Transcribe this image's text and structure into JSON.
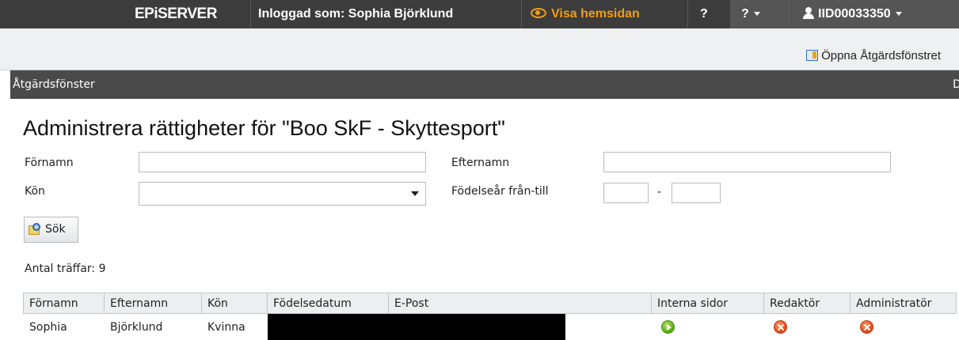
{
  "topbar": {
    "logo": "EPiSERVER",
    "logged_in_as": "Inloggad som: Sophia Björklund",
    "view_site": "Visa hemsidan",
    "help": "?",
    "help_menu": "?",
    "user_id": "IID00033350",
    "colors": {
      "bar": "#3c3c3c",
      "accent": "#f39c12"
    }
  },
  "actionbar": {
    "open_panel_link": "Öppna Åtgärdsfönstret"
  },
  "panel": {
    "title": "Åtgärdsfönster",
    "right_glyph": "D"
  },
  "page": {
    "heading": "Administrera rättigheter för \"Boo SkF - Skyttesport\""
  },
  "form": {
    "first_name_label": "Förnamn",
    "first_name_value": "",
    "last_name_label": "Efternamn",
    "last_name_value": "",
    "gender_label": "Kön",
    "gender_value": "",
    "birth_year_label": "Födelseår från-till",
    "birth_year_from": "",
    "birth_year_dash": "-",
    "birth_year_to": "",
    "search_button": "Sök"
  },
  "results": {
    "hits_label": "Antal träffar: 9",
    "columns": [
      "Förnamn",
      "Efternamn",
      "Kön",
      "Födelsedatum",
      "E-Post",
      "Interna sidor",
      "Redaktör",
      "Administratör"
    ],
    "rows": [
      {
        "first_name": "Sophia",
        "last_name": "Björklund",
        "gender": "Kvinna",
        "internal_pages": "green-play-icon",
        "editor": "red-x-icon",
        "administrator": "red-x-icon"
      }
    ]
  }
}
